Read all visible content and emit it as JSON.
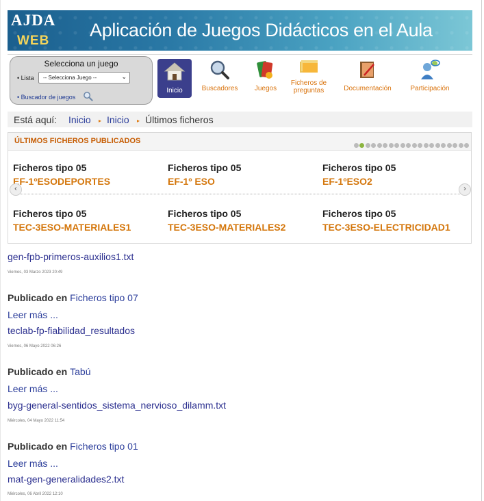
{
  "banner": {
    "logo_top": "AJDA",
    "logo_bottom": "WEB",
    "title": "Aplicación de Juegos Didácticos en el Aula"
  },
  "selector": {
    "title": "Selecciona un juego",
    "lista_label": "• Lista",
    "select_value": "-- Selecciona Juego --",
    "buscador_label": "• Buscador de juegos"
  },
  "nav": [
    {
      "label": "Inicio",
      "icon": "house-icon"
    },
    {
      "label": "Buscadores",
      "icon": "magnifier-icon"
    },
    {
      "label": "Juegos",
      "icon": "game-icon"
    },
    {
      "label": "Ficheros de preguntas",
      "icon": "folders-icon"
    },
    {
      "label": "Documentación",
      "icon": "documents-icon"
    },
    {
      "label": "Participación",
      "icon": "people-icon"
    }
  ],
  "breadcrumb": {
    "prefix": "Está aquí:",
    "items": [
      "Inicio",
      "Inicio",
      "Últimos ficheros"
    ]
  },
  "latest": {
    "title": "ÚLTIMOS FICHEROS PUBLICADOS",
    "cards": [
      {
        "type": "Ficheros tipo 05",
        "name": "EF-1ºESODEPORTES"
      },
      {
        "type": "Ficheros tipo 05",
        "name": "EF-1º ESO"
      },
      {
        "type": "Ficheros tipo 05",
        "name": "EF-1ºESO2"
      },
      {
        "type": "Ficheros tipo 05",
        "name": "TEC-3ESO-MATERIALES1"
      },
      {
        "type": "Ficheros tipo 05",
        "name": "TEC-3ESO-MATERIALES2"
      },
      {
        "type": "Ficheros tipo 05",
        "name": "TEC-3ESO-ELECTRICIDAD1"
      }
    ]
  },
  "list": {
    "published_label": "Publicado en",
    "read_more": "Leer más ...",
    "entries": [
      {
        "title": "gen-fpb-primeros-auxilios1.txt",
        "date": "Viernes, 03 Marzo 2023 20:49",
        "category": "Ficheros tipo 07"
      },
      {
        "title": "teclab-fp-fiabilidad_resultados",
        "date": "Viernes, 06 Mayo 2022 06:26",
        "category": "Tabú"
      },
      {
        "title": "byg-general-sentidos_sistema_nervioso_dilamm.txt",
        "date": "Miércoles, 04 Mayo 2022 11:54",
        "category": "Ficheros tipo 01"
      },
      {
        "title": "mat-gen-generalidades2.txt",
        "date": "Miércoles, 06 Abril 2022 12:10"
      }
    ]
  },
  "colors": {
    "accent_orange": "#d4770d",
    "link_blue": "#2a3c9a",
    "nav_active": "#3b3f8c"
  }
}
